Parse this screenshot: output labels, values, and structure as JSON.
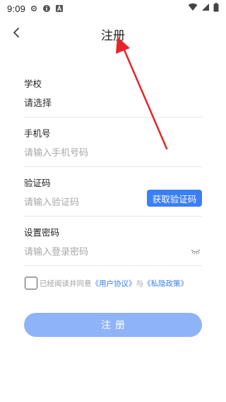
{
  "status_bar": {
    "time": "9:09",
    "left_icons": [
      "settings-gear-icon",
      "info-badge-icon",
      "font-a-icon"
    ],
    "right_icons": [
      "wifi-icon",
      "cell-signal-icon",
      "battery-icon"
    ]
  },
  "nav": {
    "title": "注册",
    "back_icon": "chevron-left-icon"
  },
  "form": {
    "school": {
      "label": "学校",
      "value": "请选择"
    },
    "phone": {
      "label": "手机号",
      "placeholder": "请输入手机号码"
    },
    "code": {
      "label": "验证码",
      "placeholder": "请输入验证码",
      "button_label": "获取验证码"
    },
    "password": {
      "label": "设置密码",
      "placeholder": "请输入登录密码",
      "toggle_icon": "eye-closed-icon"
    }
  },
  "agreement": {
    "prefix": "已经阅读并同意",
    "link_user": "《用户协议》",
    "joiner": "与",
    "link_privacy": "《私隐政策》"
  },
  "submit": {
    "label": "注册"
  },
  "colors": {
    "accent": "#3a7ff6",
    "submit_disabled": "#8fb3f7",
    "annotation_arrow": "#e8232b"
  }
}
